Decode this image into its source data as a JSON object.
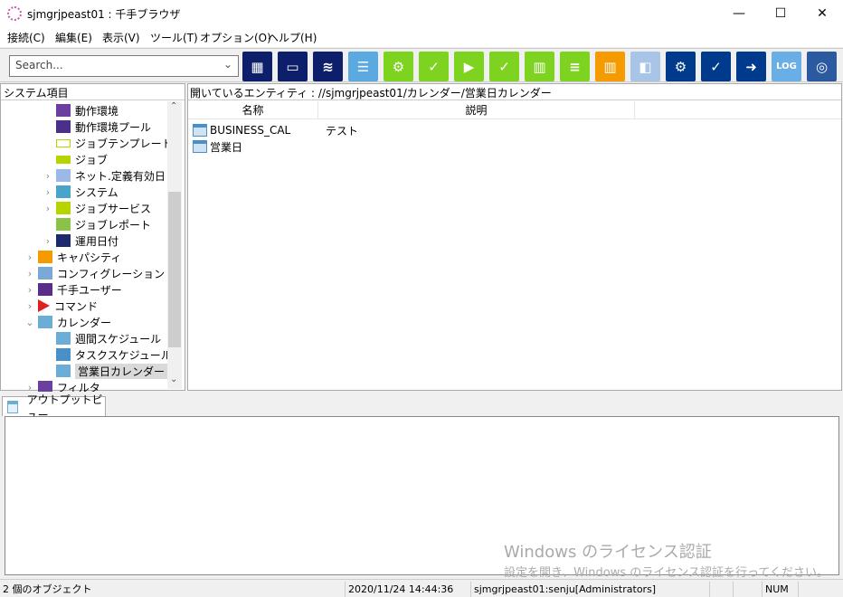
{
  "window": {
    "title": "sjmgrjpeast01 : 千手ブラウザ",
    "minimize": "—",
    "maximize": "☐",
    "close": "✕"
  },
  "menu": [
    "接続(C)",
    "編集(E)",
    "表示(V)",
    "ツール(T)",
    "オプション(O)",
    "ヘルプ(H)"
  ],
  "toolbar": {
    "search_placeholder": "Search...",
    "buttons": [
      {
        "icon": "multi-monitor-icon",
        "color": "#0d1f6b",
        "glyph": "▦"
      },
      {
        "icon": "monitor-video-icon",
        "color": "#0d1f6b",
        "glyph": "▭"
      },
      {
        "icon": "monitor-stack-icon",
        "color": "#0d1f6b",
        "glyph": "≋"
      },
      {
        "icon": "chat-icon",
        "color": "#5aa9e0",
        "glyph": "☰"
      },
      {
        "icon": "gear-job-icon",
        "color": "#7ed321",
        "glyph": "⚙"
      },
      {
        "icon": "check-job-icon",
        "color": "#7ed321",
        "glyph": "✓"
      },
      {
        "icon": "video-job-icon",
        "color": "#7ed321",
        "glyph": "▶"
      },
      {
        "icon": "monitor-check-icon",
        "color": "#7ed321",
        "glyph": "✓"
      },
      {
        "icon": "bar-chart-icon",
        "color": "#7ed321",
        "glyph": "▥"
      },
      {
        "icon": "list-report-icon",
        "color": "#7ed321",
        "glyph": "≡"
      },
      {
        "icon": "orange-chart-icon",
        "color": "#f59b00",
        "glyph": "▥"
      },
      {
        "icon": "puzzle-icon",
        "color": "#a8c4e6",
        "glyph": "◧"
      },
      {
        "icon": "gear-arrow-icon",
        "color": "#003a8c",
        "glyph": "⚙"
      },
      {
        "icon": "check-arrow-icon",
        "color": "#003a8c",
        "glyph": "✓"
      },
      {
        "icon": "video-arrow-icon",
        "color": "#003a8c",
        "glyph": "➜"
      },
      {
        "icon": "log-icon",
        "color": "#6aaee6",
        "glyph": "LOG"
      },
      {
        "icon": "radar-icon",
        "color": "#2c5aa0",
        "glyph": "◎"
      }
    ]
  },
  "tree": {
    "header": "システム項目",
    "items": [
      {
        "label": "動作環境",
        "level": 2,
        "expander": "",
        "icon": "tree-icon",
        "color": "#6b3fa0"
      },
      {
        "label": "動作環境プール",
        "level": 2,
        "expander": "",
        "icon": "grid-icon",
        "color": "#4b2f8a"
      },
      {
        "label": "ジョブテンプレート",
        "level": 2,
        "expander": "",
        "icon": "tag-outline-icon",
        "color": "#b8d400"
      },
      {
        "label": "ジョブ",
        "level": 2,
        "expander": "",
        "icon": "tag-icon",
        "color": "#b8d400"
      },
      {
        "label": "ネット.定義有効日",
        "level": 2,
        "expander": ">",
        "icon": "gear-icon",
        "color": "#9ab8e8"
      },
      {
        "label": "システム",
        "level": 2,
        "expander": ">",
        "icon": "cluster-icon",
        "color": "#4aa3c8"
      },
      {
        "label": "ジョブサービス",
        "level": 2,
        "expander": ">",
        "icon": "job-service-icon",
        "color": "#b8d400"
      },
      {
        "label": "ジョブレポート",
        "level": 2,
        "expander": "",
        "icon": "report-icon",
        "color": "#8bc34a"
      },
      {
        "label": "運用日付",
        "level": 2,
        "expander": ">",
        "icon": "calendar-date-icon",
        "color": "#1a2a6c"
      },
      {
        "label": "キャパシティ",
        "level": 1,
        "expander": ">",
        "icon": "capacity-icon",
        "color": "#f59b00"
      },
      {
        "label": "コンフィグレーション",
        "level": 1,
        "expander": ">",
        "icon": "config-icon",
        "color": "#7aa8d8"
      },
      {
        "label": "千手ユーザー",
        "level": 1,
        "expander": ">",
        "icon": "user-icon",
        "color": "#5b2d8a"
      },
      {
        "label": "コマンド",
        "level": 1,
        "expander": ">",
        "icon": "play-icon",
        "color": "#e02020"
      },
      {
        "label": "カレンダー",
        "level": 1,
        "expander": "v",
        "icon": "calendar-icon",
        "color": "#6aaed6"
      },
      {
        "label": "週間スケジュール",
        "level": 2,
        "expander": "",
        "icon": "weekly-schedule-icon",
        "color": "#6aaed6"
      },
      {
        "label": "タスクスケジュール",
        "level": 2,
        "expander": "",
        "icon": "task-schedule-icon",
        "color": "#4a8fc7"
      },
      {
        "label": "営業日カレンダー",
        "level": 2,
        "expander": "",
        "icon": "business-calendar-icon",
        "color": "#6aaed6",
        "selected": true
      },
      {
        "label": "フィルタ",
        "level": 1,
        "expander": ">",
        "icon": "filter-icon",
        "color": "#6b3fa0"
      }
    ]
  },
  "main": {
    "path": "開いているエンティティ : //sjmgrjpeast01/カレンダー/営業日カレンダー",
    "columns": [
      "名称",
      "説明"
    ],
    "rows": [
      {
        "name": "BUSINESS_CAL",
        "desc": "テスト"
      },
      {
        "name": "営業日",
        "desc": ""
      }
    ]
  },
  "output": {
    "tab": "アウトプットビュー"
  },
  "watermark": {
    "line1": "Windows のライセンス認証",
    "line2": "設定を開き、Windows のライセンス認証を行ってください。"
  },
  "status": {
    "objects": "2 個のオブジェクト",
    "datetime": "2020/11/24 14:44:36",
    "user": "sjmgrjpeast01:senju[Administrators]",
    "num": "NUM"
  }
}
